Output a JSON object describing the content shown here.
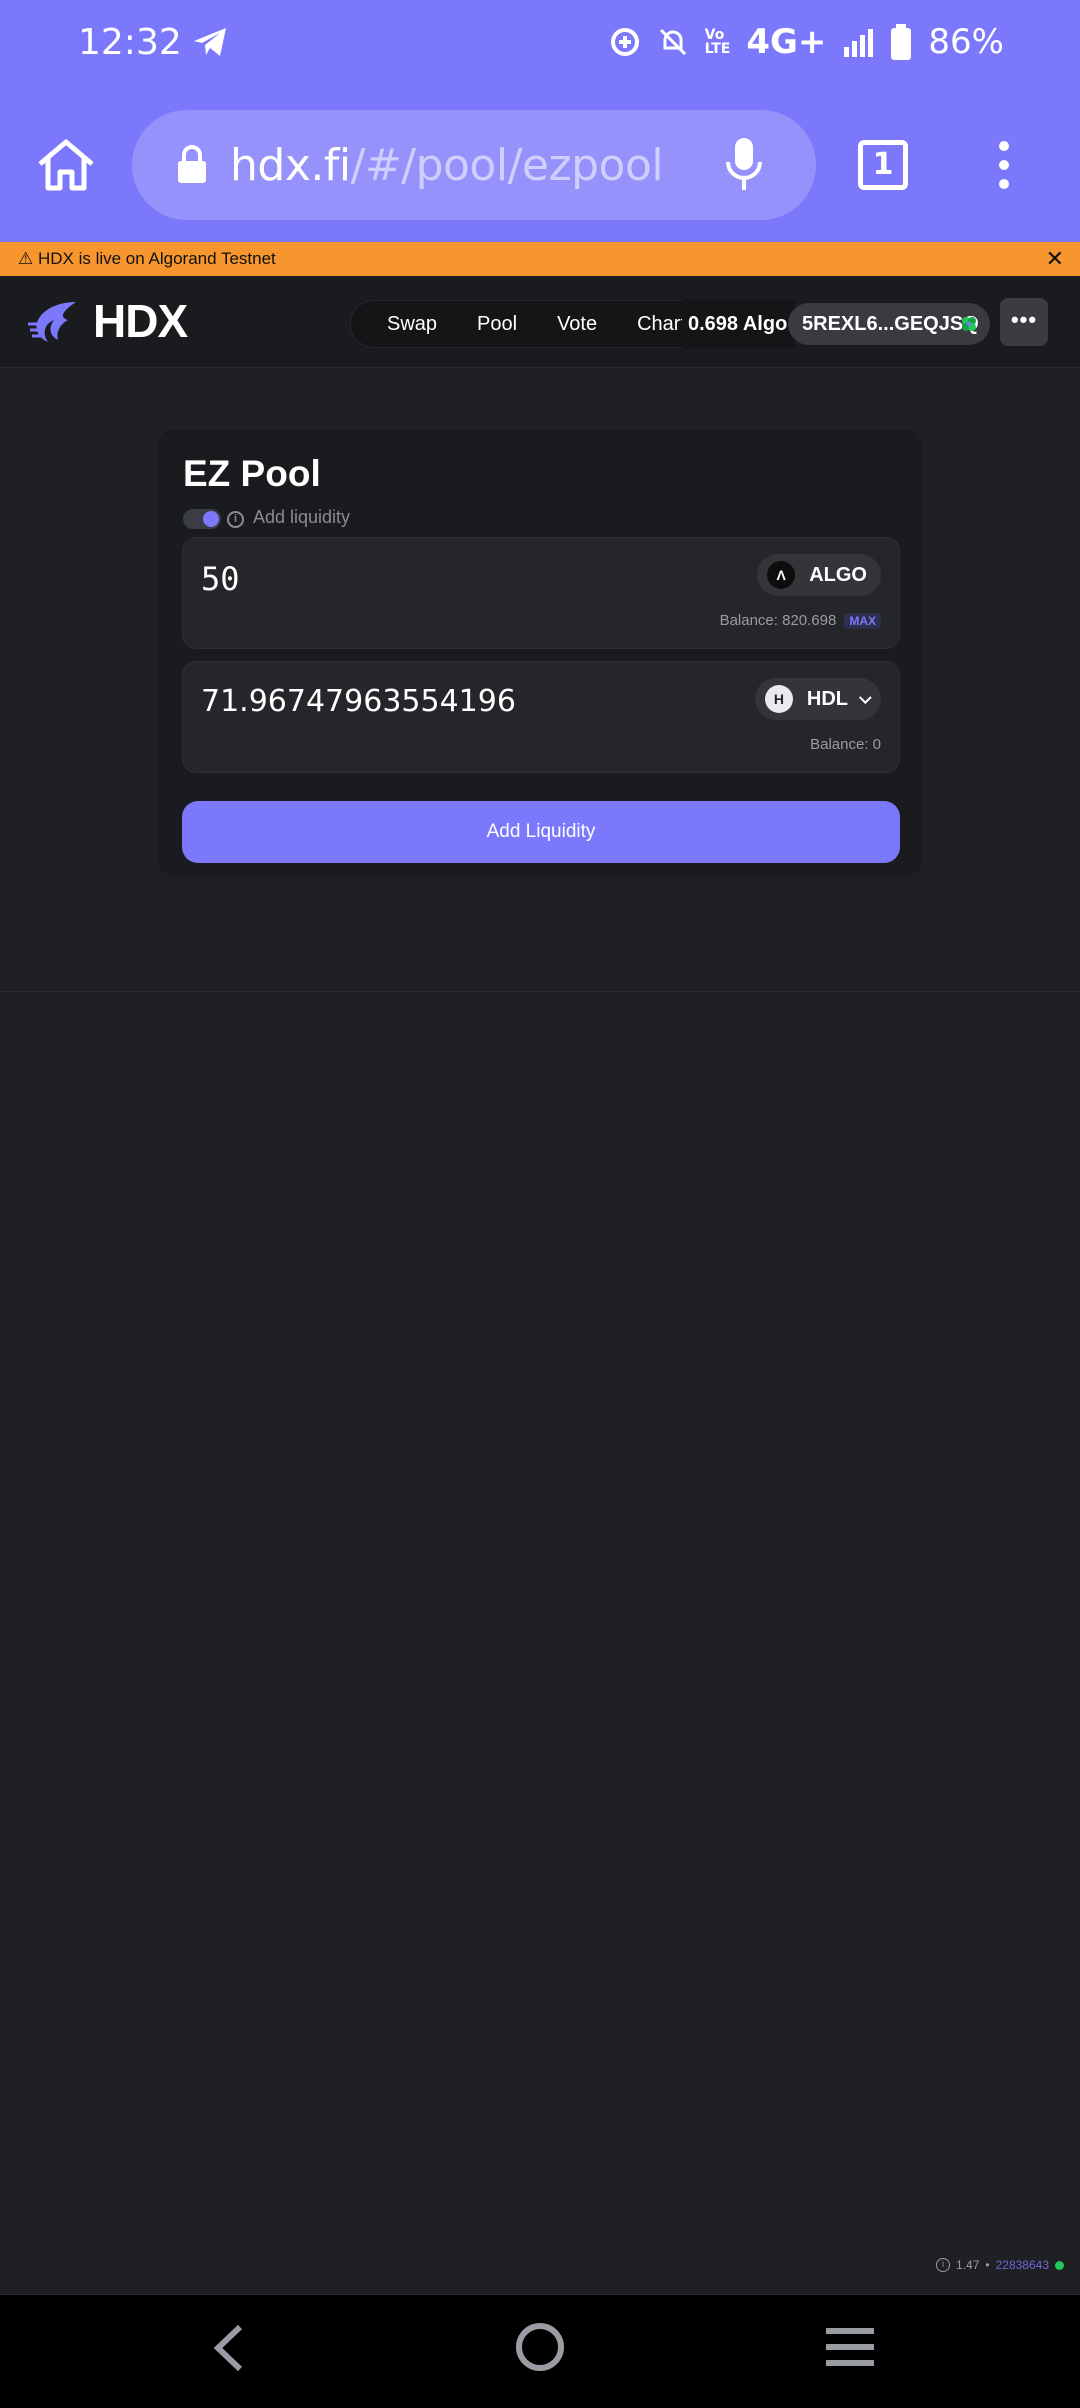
{
  "status_bar": {
    "time": "12:32",
    "network": "4G+",
    "battery": "86%"
  },
  "browser": {
    "url_host": "hdx.fi",
    "url_path": "/#/pool/ezpool",
    "tab_count": "1"
  },
  "banner": {
    "text": "⚠ HDX is live on Algorand Testnet",
    "close": "✕"
  },
  "header": {
    "logo": "HDX",
    "nav": [
      "Swap",
      "Pool",
      "Vote",
      "Charts"
    ],
    "balance": "0.698 Algo",
    "account": "5REXL6...GEQJSQ",
    "more": "•••"
  },
  "pool": {
    "title": "EZ Pool",
    "mode_label": "Add liquidity",
    "input1": {
      "value": "50",
      "token": "ALGO",
      "balance": "Balance: 820.698",
      "max": "MAX"
    },
    "input2": {
      "value": "71.96747963554196",
      "token": "HDL",
      "balance": "Balance: 0"
    },
    "button": "Add Liquidity"
  },
  "footer": {
    "version": "1.47",
    "sep": "•",
    "block": "22838643"
  },
  "colors": {
    "accent": "#7b78fb",
    "banner": "#f7962f",
    "bg": "#1f2023"
  }
}
